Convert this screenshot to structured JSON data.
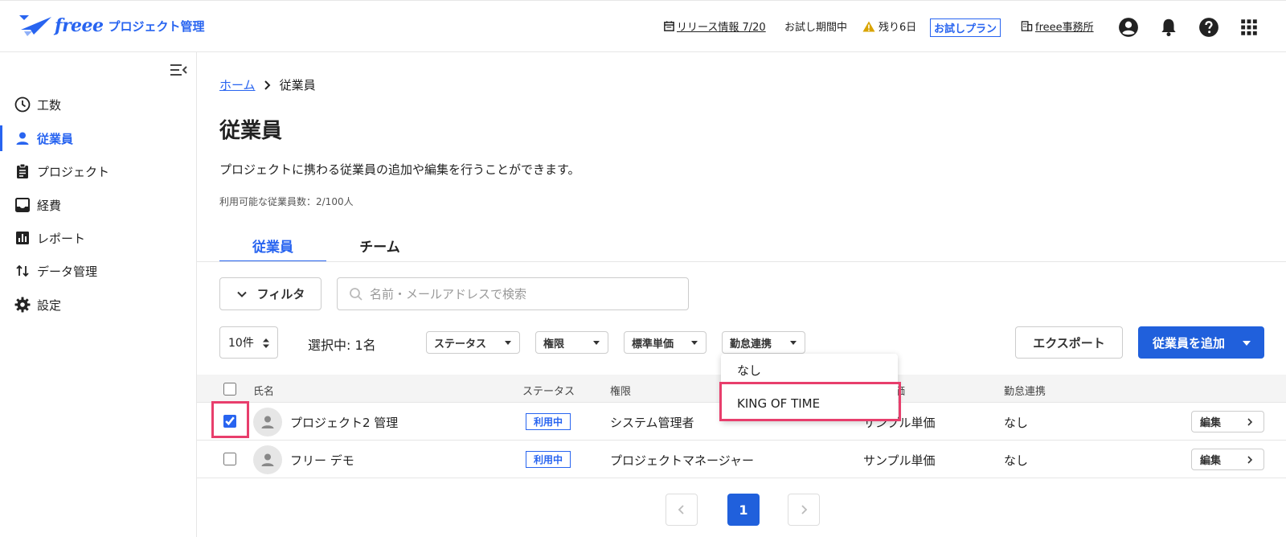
{
  "header": {
    "brand": "freee",
    "product": "プロジェクト管理",
    "release_info": "リリース情報 7/20",
    "trial_status": "お試し期間中",
    "remaining_days": "残り6日",
    "plan": "お試しプラン",
    "office": "freee事務所",
    "icons": [
      "account-icon",
      "bell-icon",
      "help-icon",
      "apps-grid-icon"
    ]
  },
  "sidebar": {
    "items": [
      {
        "label": "工数",
        "icon": "clock-icon"
      },
      {
        "label": "従業員",
        "icon": "person-icon",
        "active": true
      },
      {
        "label": "プロジェクト",
        "icon": "clipboard-icon"
      },
      {
        "label": "経費",
        "icon": "inbox-icon"
      },
      {
        "label": "レポート",
        "icon": "bar-chart-icon"
      },
      {
        "label": "データ管理",
        "icon": "swap-vert-icon"
      },
      {
        "label": "設定",
        "icon": "gear-icon"
      }
    ]
  },
  "breadcrumb": {
    "home": "ホーム",
    "current": "従業員"
  },
  "page": {
    "title": "従業員",
    "description": "プロジェクトに携わる従業員の追加や編集を行うことができます。",
    "count": "利用可能な従業員数：2/100人"
  },
  "tabs": [
    {
      "label": "従業員",
      "active": true
    },
    {
      "label": "チーム",
      "active": false
    }
  ],
  "filter_button": "フィルタ",
  "search": {
    "placeholder": "名前・メールアドレスで検索",
    "value": ""
  },
  "toolbar": {
    "per_page": "10件",
    "selected": "選択中: 1名",
    "chips": [
      "ステータス",
      "権限",
      "標準単価",
      "勤怠連携"
    ],
    "export": "エクスポート",
    "add": "従業員を追加"
  },
  "table": {
    "headers": [
      "氏名",
      "ステータス",
      "権限",
      "標準単価",
      "勤怠連携"
    ],
    "rows": [
      {
        "checked": true,
        "name": "プロジェクト2 管理",
        "status": "利用中",
        "role": "システム管理者",
        "rate": "サンプル単価",
        "attendance": "なし",
        "edit": "編集"
      },
      {
        "checked": false,
        "name": "フリー デモ",
        "status": "利用中",
        "role": "プロジェクトマネージャー",
        "rate": "サンプル単価",
        "attendance": "なし",
        "edit": "編集"
      }
    ]
  },
  "dropdown": {
    "options": [
      "なし",
      "KING OF TIME"
    ],
    "highlighted": "KING OF TIME"
  },
  "pagination": {
    "current": "1"
  },
  "colors": {
    "accent": "#2864f0",
    "primary_button": "#2060dc",
    "highlight": "#e83e6c",
    "warning": "#d9a400"
  }
}
